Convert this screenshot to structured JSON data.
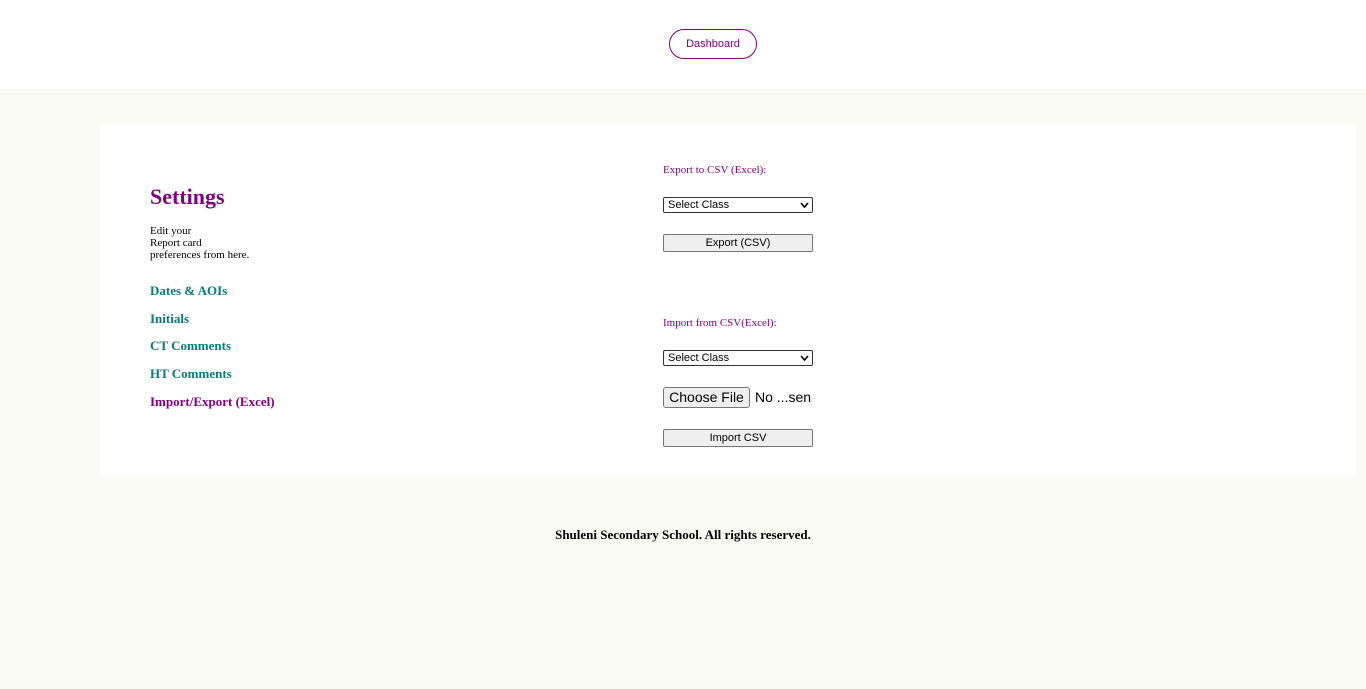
{
  "header": {
    "dashboard_label": "Dashboard"
  },
  "settings": {
    "title": "Settings",
    "description_lines": [
      "Edit your",
      "Report card",
      "preferences from here."
    ],
    "nav": [
      {
        "label": "Dates & AOIs",
        "active": false
      },
      {
        "label": "Initials",
        "active": false
      },
      {
        "label": "CT Comments",
        "active": false
      },
      {
        "label": "HT Comments",
        "active": false
      },
      {
        "label": "Import/Export (Excel)",
        "active": true
      }
    ]
  },
  "export": {
    "label": "Export to CSV (Excel):",
    "class_select": "Select Class",
    "button": "Export (CSV)"
  },
  "import": {
    "label": "Import from CSV(Excel):",
    "class_select": "Select Class",
    "file_button": "Choose File",
    "file_status": "No ...sen",
    "button": "Import CSV"
  },
  "footer": {
    "text": "Shuleni Secondary School. All rights reserved."
  },
  "colors": {
    "accent": "#800080",
    "link": "#0a7a7a",
    "page_bg": "#fafcf4",
    "card_bg": "#ffffff"
  }
}
